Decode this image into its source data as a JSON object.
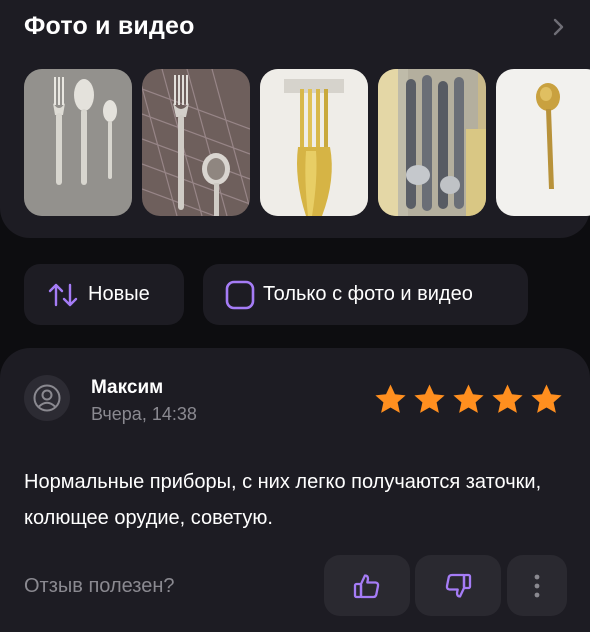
{
  "photos_section": {
    "title": "Фото и видео",
    "chevron_icon": "chevron-right-icon",
    "thumbnails": [
      {
        "name": "photo-thumbnail-1",
        "depicts": "cutlery-set-on-grey"
      },
      {
        "name": "photo-thumbnail-2",
        "depicts": "cutlery-on-patterned-surface"
      },
      {
        "name": "photo-thumbnail-3",
        "depicts": "gold-fork-on-box"
      },
      {
        "name": "photo-thumbnail-4",
        "depicts": "packaged-cutlery"
      },
      {
        "name": "photo-thumbnail-5",
        "depicts": "gold-spoon-on-white"
      }
    ]
  },
  "filters": {
    "sort_label": "Новые",
    "sort_icon": "sort-arrows-icon",
    "photo_filter_label": "Только с фото и видео",
    "photo_filter_icon": "checkbox-icon"
  },
  "review": {
    "author": "Максим",
    "date": "Вчера, 14:38",
    "rating": 5,
    "rating_max": 5,
    "text": "Нормальные приборы, с них легко получаются заточки, колющее орудие, советую.",
    "helpful_prompt": "Отзыв полезен?",
    "actions": [
      "thumbs-up-icon",
      "thumbs-down-icon",
      "more-vertical-icon"
    ]
  },
  "colors": {
    "accent": "#a57cf6",
    "star": "#ff8f1f",
    "card_background": "#1d1c23",
    "page_background": "#0d0d10",
    "muted_text": "#8a8990"
  }
}
